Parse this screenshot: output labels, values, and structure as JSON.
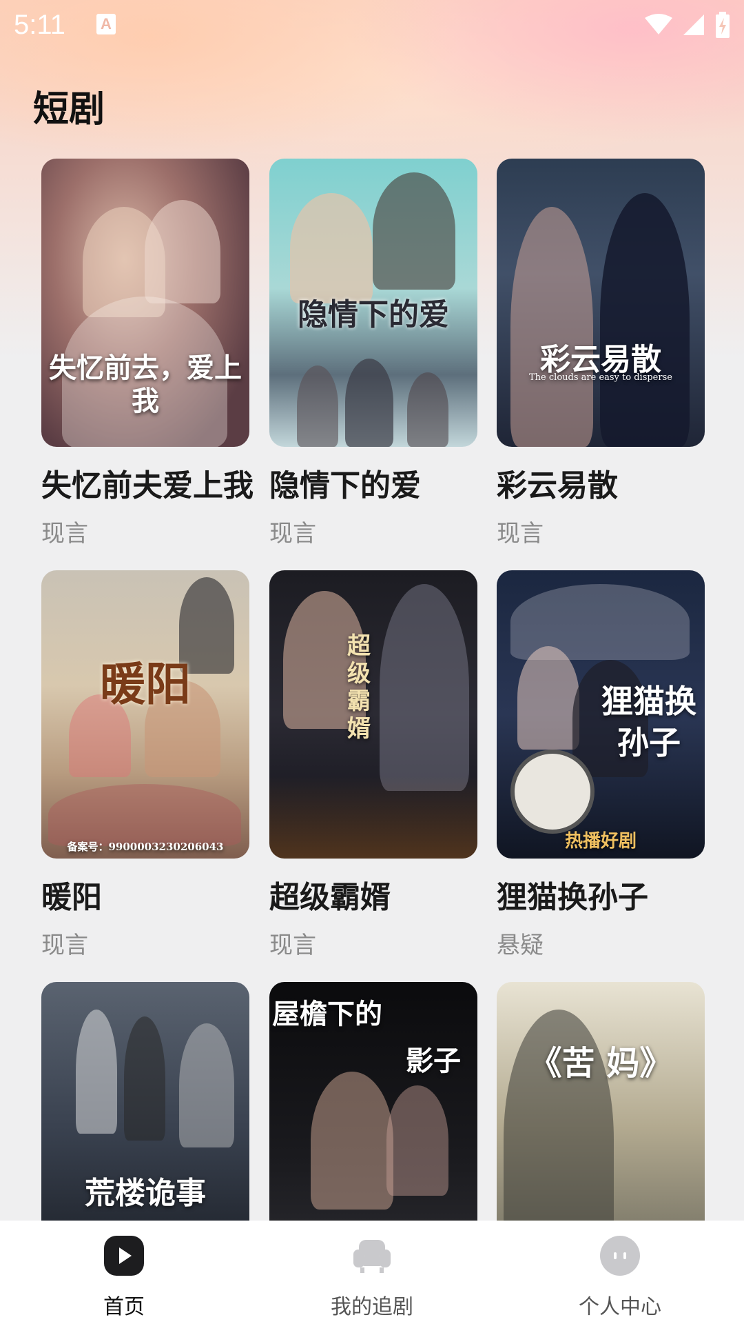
{
  "status_bar": {
    "time": "5:11"
  },
  "page_title": "短剧",
  "dramas": [
    {
      "title": "失忆前夫爱上我",
      "genre": "现言",
      "poster_text": "失忆前去，爱上我"
    },
    {
      "title": "隐情下的爱",
      "genre": "现言",
      "poster_text": "隐情下的爱"
    },
    {
      "title": "彩云易散",
      "genre": "现言",
      "poster_text": "彩云易散",
      "poster_subtext": "The clouds are easy to disperse"
    },
    {
      "title": "暖阳",
      "genre": "现言",
      "poster_text": "暖阳",
      "poster_subtext": "备案号：99000032302060​43"
    },
    {
      "title": "超级霸婿",
      "genre": "现言",
      "poster_text": "超级霸婿"
    },
    {
      "title": "狸猫换孙子",
      "genre": "悬疑",
      "poster_text": "狸猫换孙子",
      "poster_subtext": "热播好剧"
    },
    {
      "poster_text": "荒楼诡事"
    },
    {
      "poster_text": "屋檐下的",
      "poster_text2": "影子"
    },
    {
      "poster_text": "《苦 妈》"
    }
  ],
  "bottom_nav": [
    {
      "label": "首页",
      "icon": "play-icon",
      "active": true
    },
    {
      "label": "我的追剧",
      "icon": "sofa-icon",
      "active": false
    },
    {
      "label": "个人中心",
      "icon": "face-icon",
      "active": false
    }
  ],
  "colors": {
    "accent": "#1a1a1a",
    "genre_gray": "#8a8a8a",
    "nav_inactive": "#c9c9cc"
  }
}
